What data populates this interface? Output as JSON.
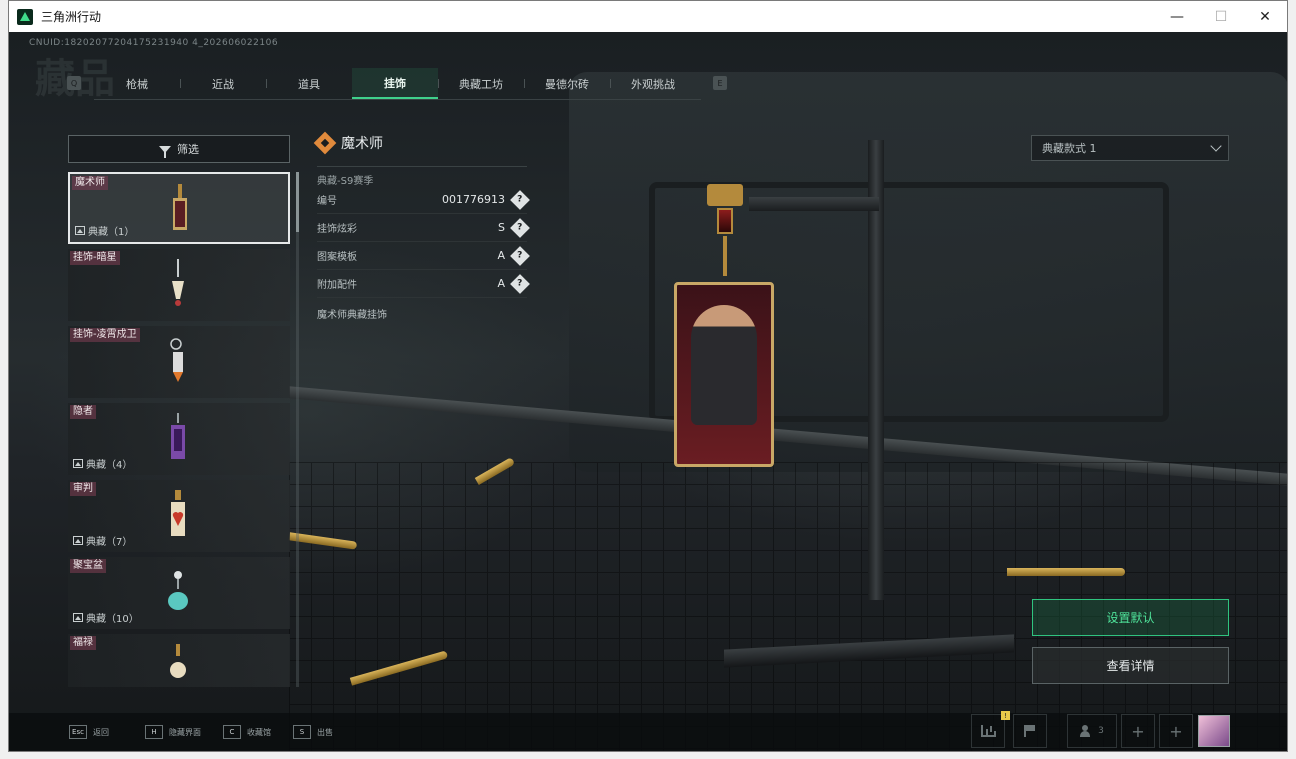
{
  "window": {
    "title": "三角洲行动",
    "minimize": "—",
    "maximize": "☐",
    "close": "✕"
  },
  "uid": "CNUID:18202077204175231940 4_202606022106",
  "bg_title": "藏品",
  "tabs": [
    {
      "label": "枪械",
      "active": false
    },
    {
      "label": "近战",
      "active": false
    },
    {
      "label": "道具",
      "active": false
    },
    {
      "label": "挂饰",
      "active": true
    },
    {
      "label": "典藏工坊",
      "active": false
    },
    {
      "label": "曼德尔砖",
      "active": false
    },
    {
      "label": "外观挑战",
      "active": false
    }
  ],
  "tab_keys": {
    "left": "Q",
    "right": "E"
  },
  "filter": {
    "label": "筛选"
  },
  "items": [
    {
      "name": "魔术师",
      "count": "典藏（1）",
      "selected": true
    },
    {
      "name": "挂饰-暗星",
      "count": "",
      "selected": false
    },
    {
      "name": "挂饰-凌霄戍卫",
      "count": "",
      "selected": false
    },
    {
      "name": "隐者",
      "count": "典藏（4）",
      "selected": false
    },
    {
      "name": "审判",
      "count": "典藏（7）",
      "selected": false
    },
    {
      "name": "聚宝盆",
      "count": "典藏（10）",
      "selected": false
    },
    {
      "name": "福禄",
      "count": "",
      "selected": false
    }
  ],
  "detail": {
    "title": "魔术师",
    "season": "典藏-S9赛季",
    "rows": [
      {
        "label": "编号",
        "value": "001776913"
      },
      {
        "label": "挂饰炫彩",
        "value": "S"
      },
      {
        "label": "图案模板",
        "value": "A"
      },
      {
        "label": "附加配件",
        "value": "A"
      }
    ],
    "help": "?",
    "description": "魔术师典藏挂饰"
  },
  "style_select": {
    "value": "典藏款式 1"
  },
  "actions": {
    "set_default": "设置默认",
    "view_details": "查看详情"
  },
  "bottom_hints": [
    {
      "key": "Esc",
      "label": "返回"
    },
    {
      "key": "H",
      "label": "隐藏界面"
    },
    {
      "key": "C",
      "label": "收藏馆"
    },
    {
      "key": "S",
      "label": "出售"
    }
  ],
  "bottom_right": {
    "badge": "!",
    "friends_count": "3",
    "add": "+"
  },
  "colors": {
    "accent": "#3fd08c",
    "bg": "#0d0f11",
    "pendant_gold": "#c9a866",
    "tag_bg": "#783c50"
  }
}
